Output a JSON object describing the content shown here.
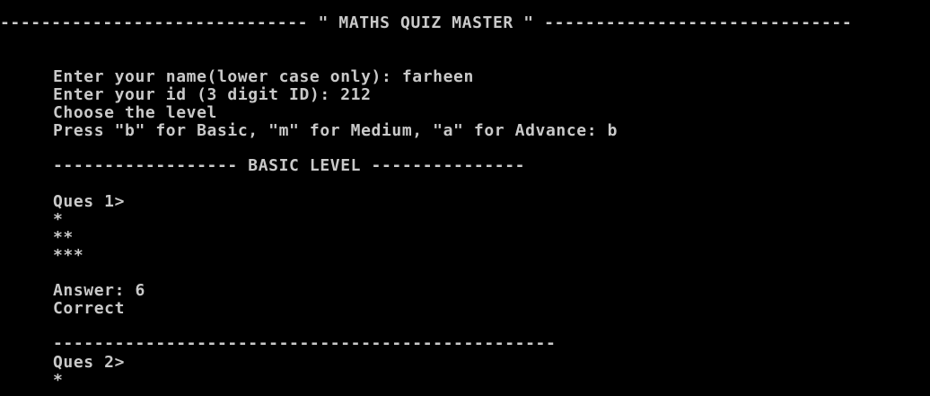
{
  "console": {
    "lines": [
      "------------------------------ \" MATHS QUIZ MASTER \" ------------------------------",
      "Enter your name(lower case only): farheen",
      "Enter your id (3 digit ID): 212",
      "Choose the level",
      "Press \"b\" for Basic, \"m\" for Medium, \"a\" for Advance: b",
      "------------------ BASIC LEVEL ---------------",
      "Ques 1>",
      "*",
      "**",
      "***",
      "Answer: 6",
      "Correct",
      "-------------------------------------------------",
      "Ques 2>",
      "*"
    ]
  },
  "colors": {
    "background": "#000000",
    "text": "#c9c9c9"
  }
}
